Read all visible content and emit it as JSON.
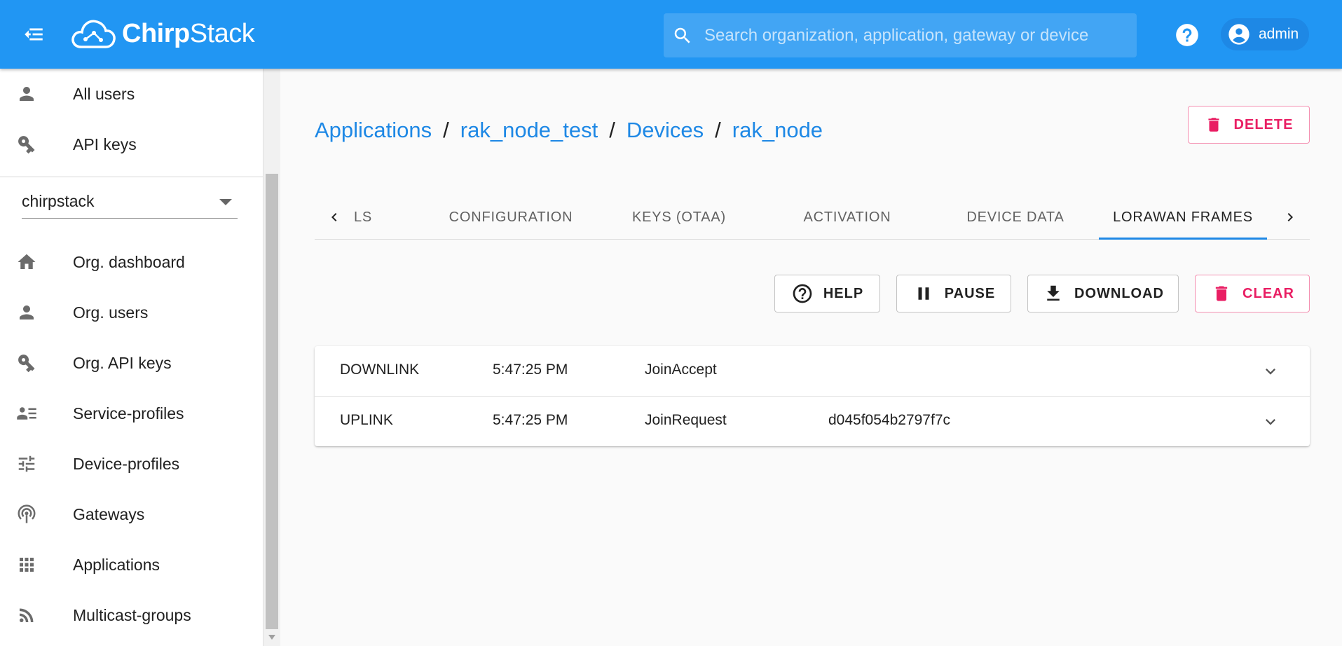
{
  "header": {
    "logo_text_bold": "Chirp",
    "logo_text_light": "Stack",
    "search_placeholder": "Search organization, application, gateway or device",
    "user": "admin"
  },
  "sidebar": {
    "admin_items": [
      {
        "label": "All users",
        "icon": "person-icon"
      },
      {
        "label": "API keys",
        "icon": "key-icon"
      }
    ],
    "org_select_value": "chirpstack",
    "org_items": [
      {
        "label": "Org. dashboard",
        "icon": "home-icon"
      },
      {
        "label": "Org. users",
        "icon": "person-icon"
      },
      {
        "label": "Org. API keys",
        "icon": "key-icon"
      },
      {
        "label": "Service-profiles",
        "icon": "account-details-icon"
      },
      {
        "label": "Device-profiles",
        "icon": "tune-icon"
      },
      {
        "label": "Gateways",
        "icon": "access-point-icon"
      },
      {
        "label": "Applications",
        "icon": "apps-icon"
      },
      {
        "label": "Multicast-groups",
        "icon": "rss-icon"
      }
    ]
  },
  "breadcrumb": {
    "items": [
      "Applications",
      "rak_node_test",
      "Devices",
      "rak_node"
    ],
    "separator": "/"
  },
  "delete_label": "DELETE",
  "tabs": {
    "items": [
      "LS",
      "CONFIGURATION",
      "KEYS (OTAA)",
      "ACTIVATION",
      "DEVICE DATA",
      "LORAWAN FRAMES"
    ],
    "active": "LORAWAN FRAMES"
  },
  "actions": {
    "help": "HELP",
    "pause": "PAUSE",
    "download": "DOWNLOAD",
    "clear": "CLEAR"
  },
  "frames": [
    {
      "direction": "DOWNLINK",
      "time": "5:47:25 PM",
      "type": "JoinAccept",
      "dev_eui": ""
    },
    {
      "direction": "UPLINK",
      "time": "5:47:25 PM",
      "type": "JoinRequest",
      "dev_eui": "d045f054b2797f7c"
    }
  ],
  "colors": {
    "primary": "#2196f3",
    "link": "#1e88e5",
    "danger": "#e91e63"
  }
}
